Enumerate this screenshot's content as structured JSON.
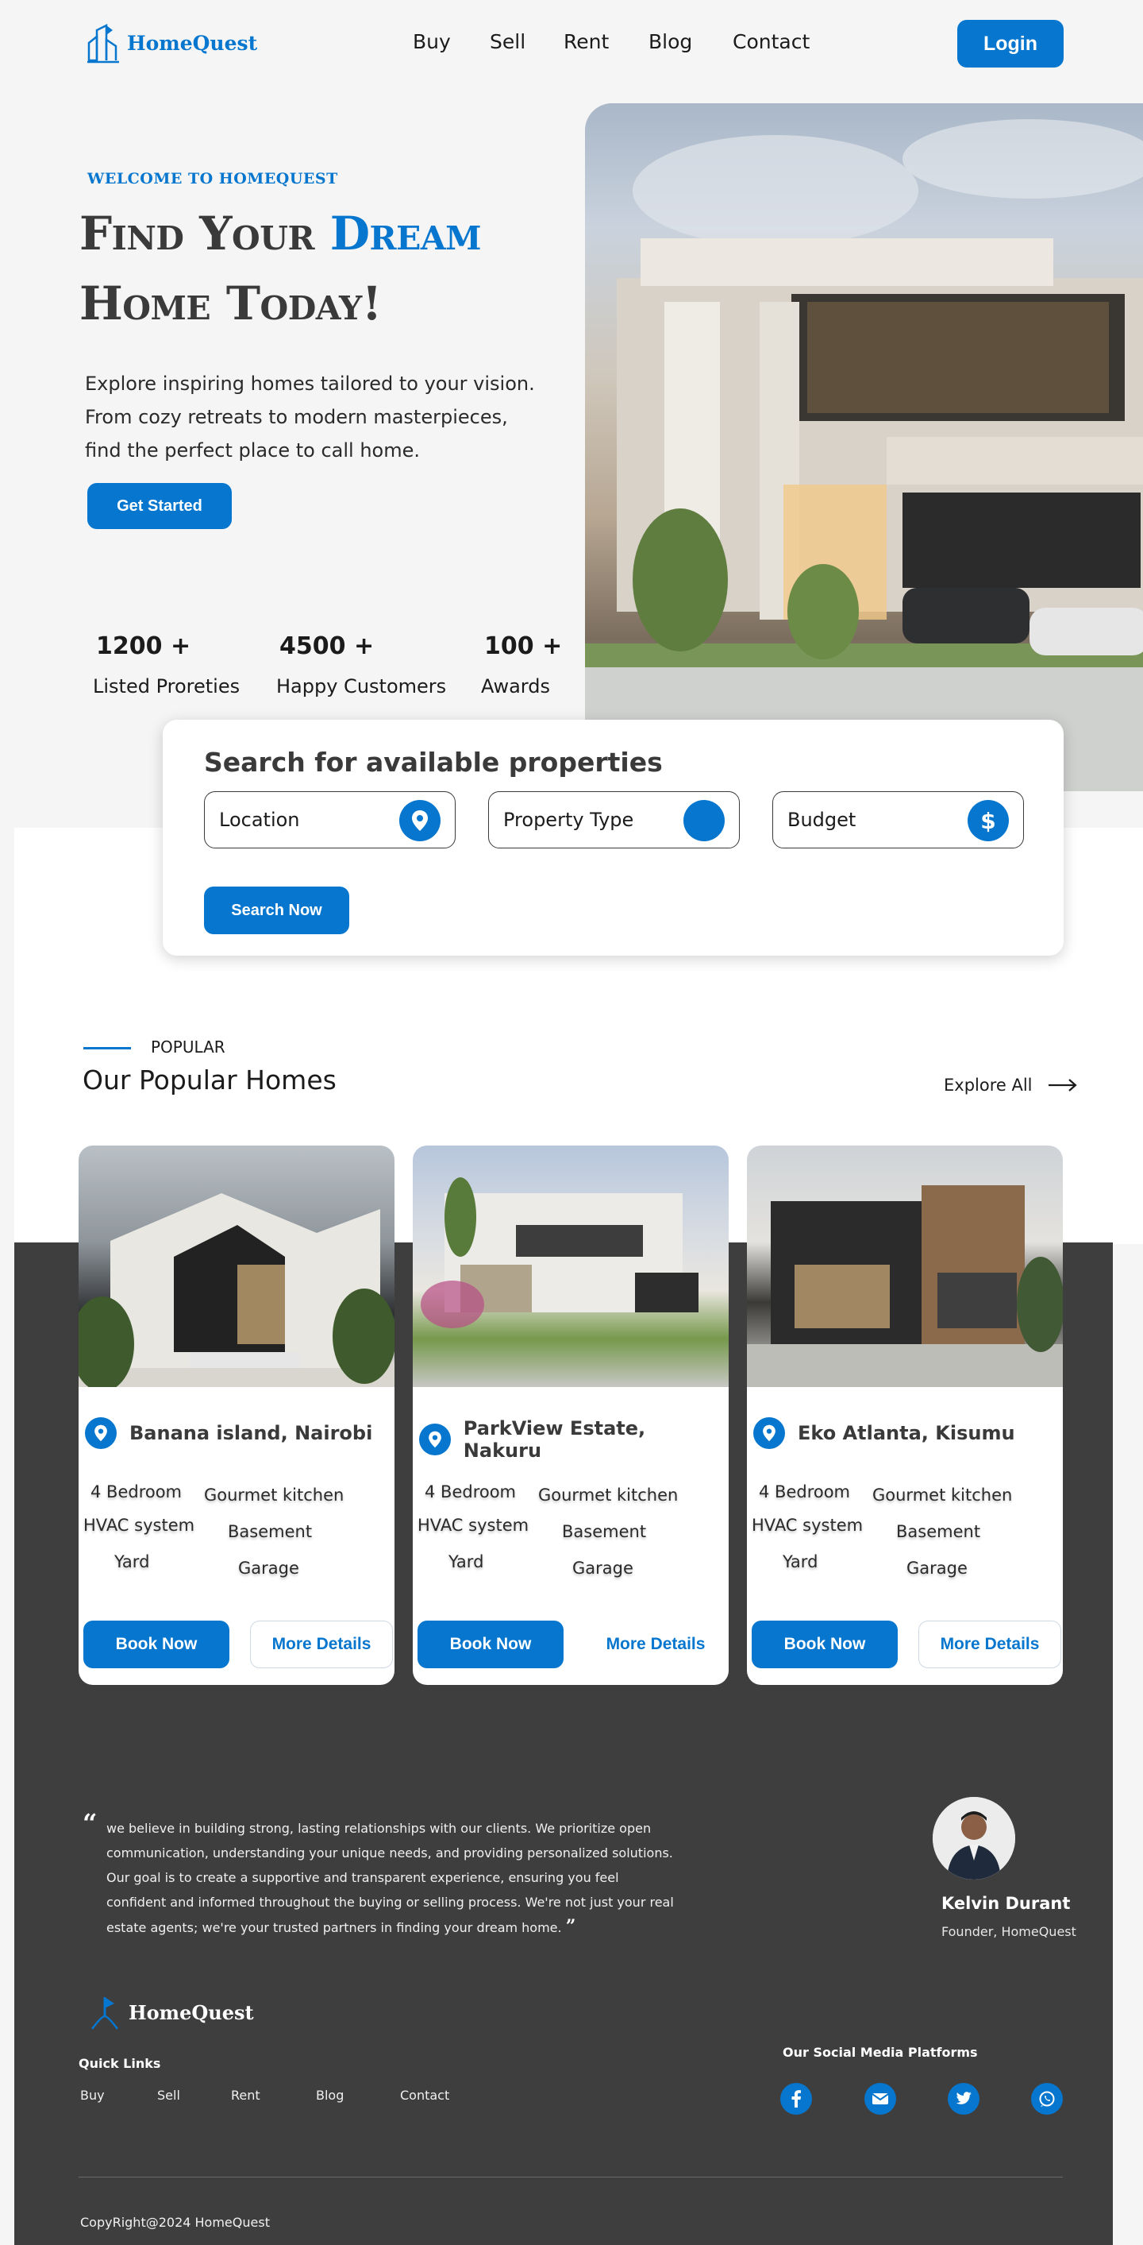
{
  "header": {
    "brand": "HomeQuest",
    "nav": [
      "Buy",
      "Sell",
      "Rent",
      "Blog",
      "Contact"
    ],
    "login_label": "Login"
  },
  "hero": {
    "kicker": "WELCOME TO HOMEQUEST",
    "title_part1": "Find Your ",
    "title_highlight": "Dream",
    "title_line2": "Home Today!",
    "description": "Explore inspiring homes tailored to your vision. From cozy retreats to modern masterpieces, find the perfect place to call home.",
    "cta_label": "Get Started",
    "stats": [
      {
        "value": "1200 +",
        "label": "Listed Proreties"
      },
      {
        "value": "4500 +",
        "label": "Happy Customers"
      },
      {
        "value": "100 +",
        "label": "Awards"
      }
    ]
  },
  "search": {
    "title": "Search for available properties",
    "fields": [
      "Location",
      "Property Type",
      "Budget"
    ],
    "button_label": "Search Now"
  },
  "popular": {
    "kicker": "POPULAR",
    "title": "Our Popular Homes",
    "explore_label": "Explore All",
    "cards": [
      {
        "location": "Banana island, Nairobi",
        "features": [
          "4 Bedroom",
          "HVAC system",
          "Yard",
          "Gourmet kitchen",
          "Basement",
          "Garage"
        ],
        "book_label": "Book Now",
        "more_label": "More Details"
      },
      {
        "location": "ParkView Estate, Nakuru",
        "features": [
          "4 Bedroom",
          "HVAC system",
          "Yard",
          "Gourmet kitchen",
          "Basement",
          "Garage"
        ],
        "book_label": "Book Now",
        "more_label": "More Details"
      },
      {
        "location": "Eko Atlanta, Kisumu",
        "features": [
          "4 Bedroom",
          "HVAC system",
          "Yard",
          "Gourmet kitchen",
          "Basement",
          "Garage"
        ],
        "book_label": "Book Now",
        "more_label": "More Details"
      }
    ]
  },
  "testimonial": {
    "text": "we believe in building strong, lasting relationships with our clients. We prioritize open communication, understanding your unique needs, and providing personalized solutions. Our goal is to create a supportive and transparent experience, ensuring you feel confident and informed throughout the buying or selling process. We're not just your real estate agents; we're your trusted partners in finding your dream home.",
    "name": "Kelvin Durant",
    "role": "Founder, HomeQuest"
  },
  "footer": {
    "brand": "HomeQuest",
    "quick_links_title": "Quick Links",
    "quick_links": [
      "Buy",
      "Sell",
      "Rent",
      "Blog",
      "Contact"
    ],
    "social_title": "Our Social Media Platforms",
    "social_icons": [
      "facebook-icon",
      "email-icon",
      "twitter-icon",
      "whatsapp-icon"
    ],
    "copyright": "CopyRight@2024  HomeQuest"
  },
  "colors": {
    "accent": "#0676ce",
    "dark_band": "#3e3e3e",
    "page_bg": "#f5f5f5"
  }
}
